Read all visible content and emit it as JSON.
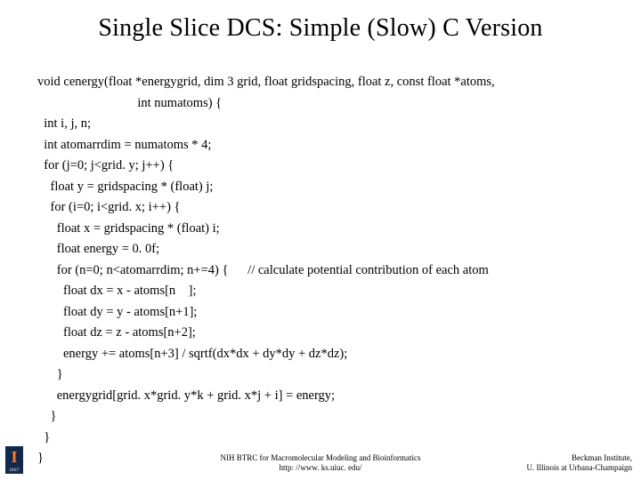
{
  "title": "Single Slice DCS: Simple (Slow) C Version",
  "code": {
    "l01": "void cenergy(float *energygrid, dim 3 grid, float gridspacing, float z, const float *atoms,",
    "l02": "                               int numatoms) {",
    "l03": "  int i, j, n;",
    "l04": "  int atomarrdim = numatoms * 4;",
    "l05": "  for (j=0; j<grid. y; j++) {",
    "l06": "    float y = gridspacing * (float) j;",
    "l07": "    for (i=0; i<grid. x; i++) {",
    "l08": "      float x = gridspacing * (float) i;",
    "l09": "      float energy = 0. 0f;",
    "l10": "      for (n=0; n<atomarrdim; n+=4) {      // calculate potential contribution of each atom",
    "l11": "        float dx = x - atoms[n    ];",
    "l12": "        float dy = y - atoms[n+1];",
    "l13": "        float dz = z - atoms[n+2];",
    "l14": "        energy += atoms[n+3] / sqrtf(dx*dx + dy*dy + dz*dz);",
    "l15": "      }",
    "l16": "      energygrid[grid. x*grid. y*k + grid. x*j + i] = energy;",
    "l17": "    }",
    "l18": "  }",
    "l19": "}"
  },
  "footer": {
    "logo_year": "1867",
    "center_line1": "NIH BTRC for Macromolecular Modeling and Bioinformatics",
    "center_line2": "http: //www. ks.uiuc. edu/",
    "right_line1": "Beckman Institute,",
    "right_line2": "U. Illinois at Urbana-Champaign"
  }
}
